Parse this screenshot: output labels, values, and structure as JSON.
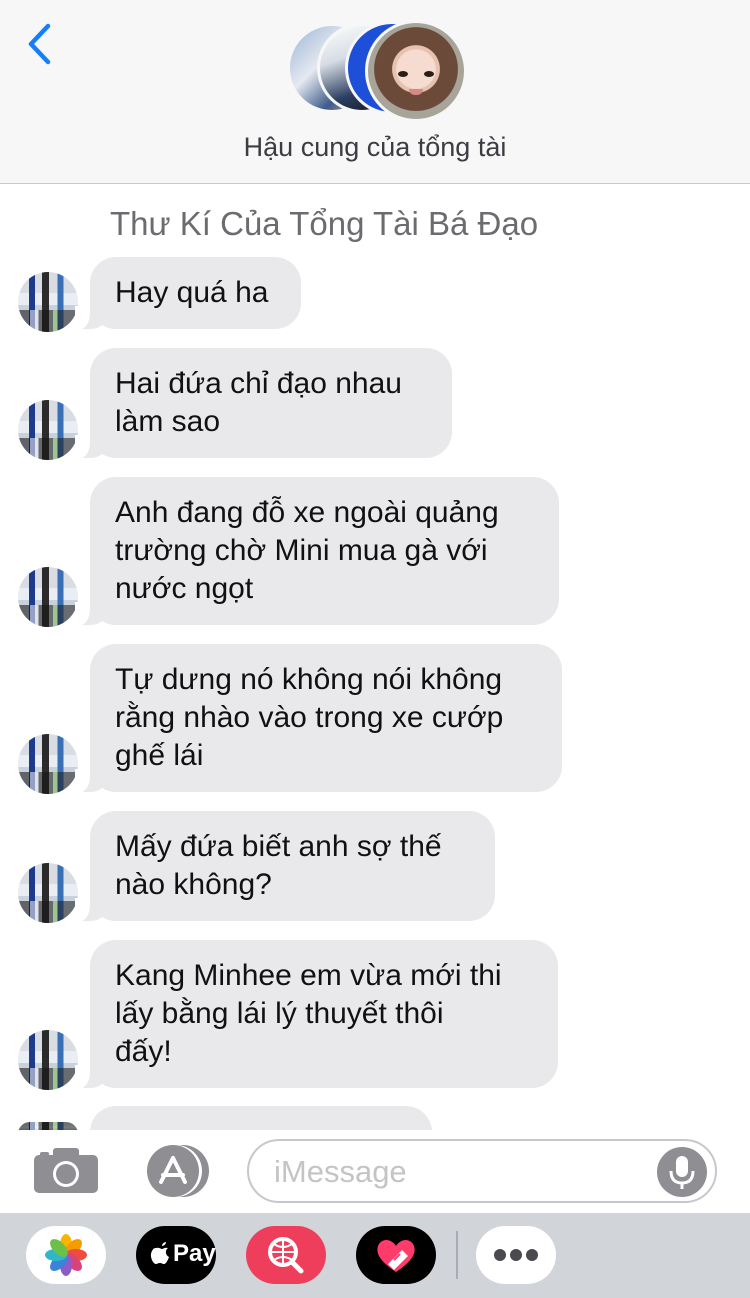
{
  "header": {
    "back_icon": "chevron-left-icon",
    "group_name": "Hậu cung của tổng tài"
  },
  "chat": {
    "sender_name": "Thư Kí Của Tổng Tài Bá Đạo",
    "messages": [
      {
        "text": "Hay quá ha"
      },
      {
        "text": "Hai đứa chỉ đạo nhau\nlàm sao"
      },
      {
        "text": "Anh đang đỗ xe ngoài quảng\ntrường chờ Mini mua gà với\nnước ngọt"
      },
      {
        "text": "Tự dưng nó không nói không\nrằng nhào vào trong xe cướp\nghế lái"
      },
      {
        "text": "Mấy đứa biết anh sợ thế\nnào không?"
      },
      {
        "text": "Kang Minhee em vừa mới thi\nlấy bằng lái lý thuyết thôi\nđấy!"
      }
    ]
  },
  "composer": {
    "placeholder": "iMessage",
    "camera_icon": "camera-icon",
    "appstore_icon": "app-store-icon",
    "mic_icon": "microphone-icon"
  },
  "drawer": {
    "apps": [
      {
        "name": "photos-icon"
      },
      {
        "name": "apple-pay-icon",
        "label": "Pay"
      },
      {
        "name": "image-search-icon"
      },
      {
        "name": "digital-touch-icon"
      },
      {
        "name": "more-icon"
      }
    ]
  },
  "colors": {
    "accent": "#147efb",
    "bubble_incoming": "#e9e9eb",
    "header_bg": "#f7f7f7",
    "drawer_bg": "#d1d4d9"
  }
}
